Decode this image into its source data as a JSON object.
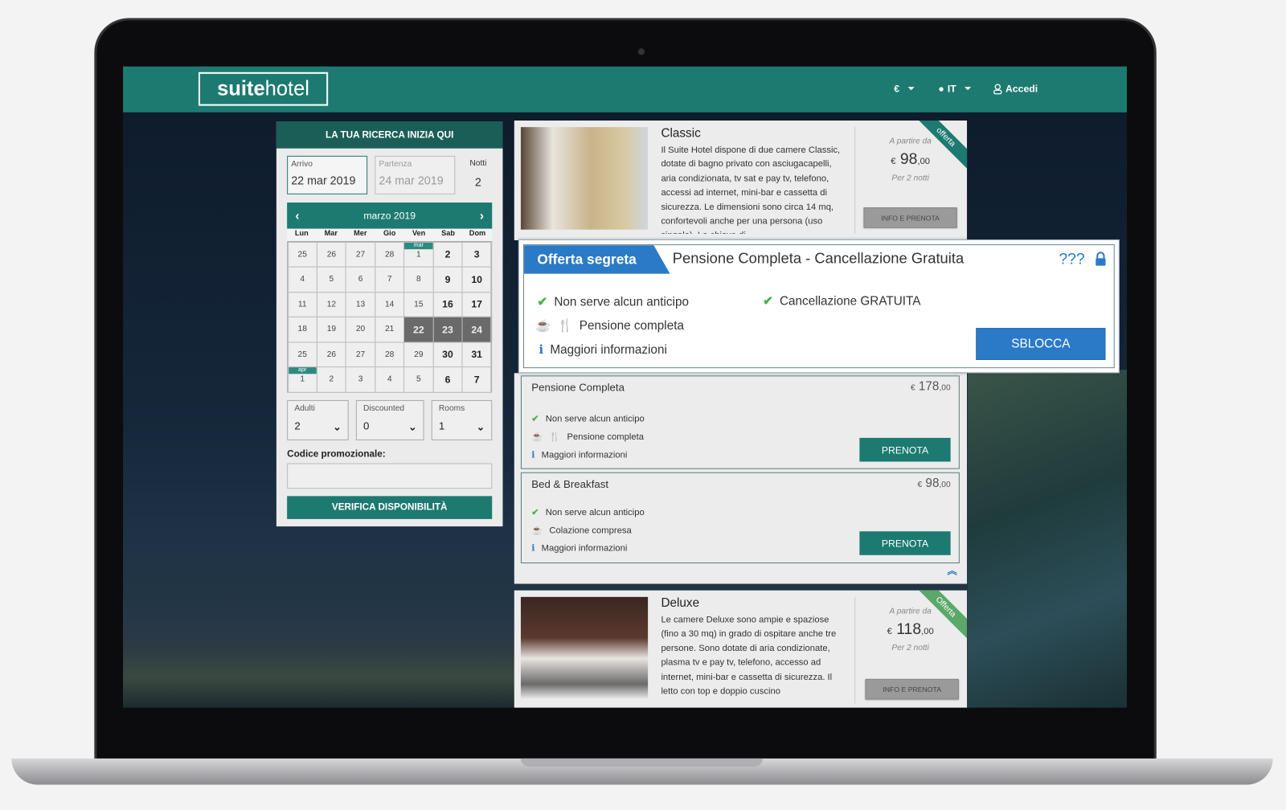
{
  "colors": {
    "brand": "#1d7a70",
    "brand_dark": "#1b5e58",
    "secret_blue": "#2b7ac7",
    "check_green": "#4caf50",
    "offer_ribbon": "#1d7a70"
  },
  "header": {
    "logo_bold": "suite",
    "logo_light": "hotel",
    "currency": "€",
    "language": "IT",
    "login": "Accedi"
  },
  "search": {
    "title": "LA TUA RICERCA INIZIA QUI",
    "arrival_label": "Arrivo",
    "arrival_value": "22 mar 2019",
    "departure_label": "Partenza",
    "departure_value": "24 mar 2019",
    "nights_label": "Notti",
    "nights_value": "2",
    "calendar": {
      "month": "marzo 2019",
      "weekdays": [
        "Lun",
        "Mar",
        "Mer",
        "Gio",
        "Ven",
        "Sab",
        "Dom"
      ],
      "days": [
        {
          "d": "25"
        },
        {
          "d": "26"
        },
        {
          "d": "27"
        },
        {
          "d": "28"
        },
        {
          "d": "1",
          "tag": "mar"
        },
        {
          "d": "2",
          "bold": true
        },
        {
          "d": "3",
          "bold": true
        },
        {
          "d": "4"
        },
        {
          "d": "5"
        },
        {
          "d": "6"
        },
        {
          "d": "7"
        },
        {
          "d": "8"
        },
        {
          "d": "9",
          "bold": true
        },
        {
          "d": "10",
          "bold": true
        },
        {
          "d": "11"
        },
        {
          "d": "12"
        },
        {
          "d": "13"
        },
        {
          "d": "14"
        },
        {
          "d": "15"
        },
        {
          "d": "16",
          "bold": true
        },
        {
          "d": "17",
          "bold": true
        },
        {
          "d": "18"
        },
        {
          "d": "19"
        },
        {
          "d": "20"
        },
        {
          "d": "21"
        },
        {
          "d": "22",
          "selected": true
        },
        {
          "d": "23",
          "selected": true
        },
        {
          "d": "24",
          "selected": true
        },
        {
          "d": "25"
        },
        {
          "d": "26"
        },
        {
          "d": "27"
        },
        {
          "d": "28"
        },
        {
          "d": "29"
        },
        {
          "d": "30",
          "bold": true
        },
        {
          "d": "31",
          "bold": true
        },
        {
          "d": "1",
          "tag": "apr"
        },
        {
          "d": "2"
        },
        {
          "d": "3"
        },
        {
          "d": "4"
        },
        {
          "d": "5"
        },
        {
          "d": "6",
          "bold": true
        },
        {
          "d": "7",
          "bold": true
        }
      ]
    },
    "adults_label": "Adulti",
    "adults_value": "2",
    "discounted_label": "Discounted",
    "discounted_value": "0",
    "rooms_label": "Rooms",
    "rooms_value": "1",
    "promo_label": "Codice promozionale:",
    "promo_value": "",
    "verify_button": "VERIFICA DISPONIBILITÀ"
  },
  "rooms": [
    {
      "name": "Classic",
      "description": "Il Suite Hotel dispone di due camere Classic, dotate di bagno privato con asciugacapelli, aria condizionata, tv sat e pay tv, telefono, accessi ad internet, mini-bar e cassetta di sicurezza. Le dimensioni sono circa 14 mq, confortevoli anche per una persona (uso singola). La chiave di",
      "from": "A partire da",
      "currency": "€",
      "price_int": "98",
      "price_dec": ",00",
      "per": "Per 2 notti",
      "button": "INFO E PRENOTA",
      "ribbon": "offerta"
    },
    {
      "name": "Deluxe",
      "description": "Le camere Deluxe sono ampie e spaziose (fino a 30 mq) in grado di ospitare anche tre persone. Sono dotate di aria condizionate, plasma tv e pay tv, telefono, accesso ad internet, mini-bar e cassetta di sicurezza. Il letto con top e doppio cuscino",
      "from": "A partire da",
      "currency": "€",
      "price_int": "118",
      "price_dec": ",00",
      "per": "Per 2 notti",
      "button": "INFO E PRENOTA",
      "ribbon": "Offerta"
    }
  ],
  "secret_offer": {
    "tab": "Offerta segreta",
    "title": "Pensione Completa - Cancellazione Gratuita",
    "hidden_price": "???",
    "feature1": "Non serve alcun anticipo",
    "feature2": "Pensione completa",
    "feature3": "Maggiori informazioni",
    "feature4": "Cancellazione GRATUITA",
    "unlock_button": "SBLOCCA"
  },
  "rates": [
    {
      "name": "Pensione Completa",
      "currency": "€",
      "price_int": "178",
      "price_dec": ",00",
      "f1": "Non serve alcun anticipo",
      "f2": "Pensione completa",
      "f3": "Maggiori informazioni",
      "button": "PRENOTA"
    },
    {
      "name": "Bed & Breakfast",
      "currency": "€",
      "price_int": "98",
      "price_dec": ",00",
      "f1": "Non serve alcun anticipo",
      "f2": "Colazione compresa",
      "f3": "Maggiori informazioni",
      "button": "PRENOTA"
    }
  ]
}
